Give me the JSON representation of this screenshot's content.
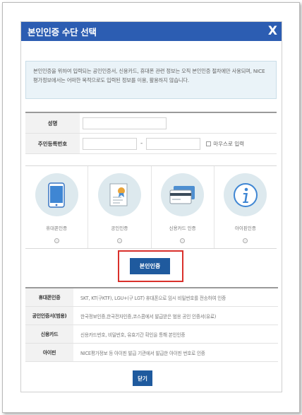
{
  "dialog": {
    "title": "본인인증 수단 선택",
    "close_glyph": "X",
    "notice": "본인인증을 위하여 입력되는 공인인증서, 신용카드, 휴대폰 관련 정보는 오직 본인인증 절차에만 사용되며, NICE평가정보에서는 어떠한 목적으로도 입력된 정보를 이용, 활용하지 않습니다."
  },
  "form": {
    "name_label": "성명",
    "rrn_label": "주민등록번호",
    "name_value": "",
    "rrn_front_value": "",
    "rrn_back_value": "",
    "rrn_separator": "-",
    "mouse_input_label": "마우스로 입력"
  },
  "methods": [
    {
      "label": "휴대폰인증",
      "icon": "phone-icon"
    },
    {
      "label": "공인인증",
      "icon": "certificate-icon"
    },
    {
      "label": "신용카드 인증",
      "icon": "credit-card-icon"
    },
    {
      "label": "아이핀인증",
      "icon": "info-icon"
    }
  ],
  "verify_button": "본인인증",
  "info_rows": [
    {
      "head": "휴대폰인증",
      "desc": "SKT, KT(구KTF), LGU+(구 LGT) 휴대폰으로 임시 비밀번호를 전송하여 인증"
    },
    {
      "head": "공인인증서(범용)",
      "desc": "한국정보인증,한국전자인증,코스콤에서 발급받은 범용 공인 인증서(유료)"
    },
    {
      "head": "신용카드",
      "desc": "신용카드번호, 비밀번호, 유효기간 확인을 통해 본인인증"
    },
    {
      "head": "아이핀",
      "desc": "NICE평가정보 등 아이핀 발급 기관에서 발급한 아이핀 번호로 인증"
    }
  ],
  "close_button": "닫기",
  "colors": {
    "titlebar": "#2c5db2",
    "button": "#1f5a9e",
    "highlight": "#d9302b",
    "icon_circle": "#dde9ee"
  }
}
